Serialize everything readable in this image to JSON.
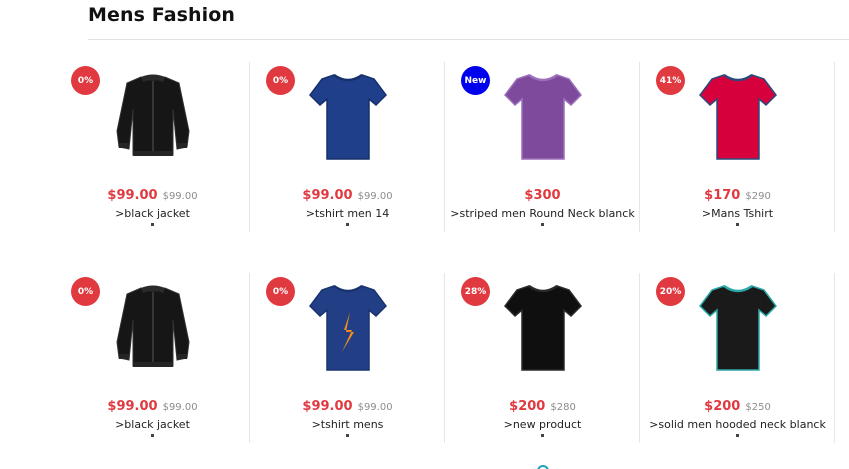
{
  "section": {
    "title": "Mens Fashion"
  },
  "colors": {
    "accent": "#e0393f",
    "badge_sale": "#e0393f",
    "badge_new": "#0000ee"
  },
  "products": [
    {
      "badge": "0%",
      "badge_type": "sale",
      "price": "$99.00",
      "old_price": "$99.00",
      "name": ">black jacket",
      "image": "black-jacket"
    },
    {
      "badge": "0%",
      "badge_type": "sale",
      "price": "$99.00",
      "old_price": "$99.00",
      "name": ">tshirt men 14",
      "image": "navy-tshirt"
    },
    {
      "badge": "New",
      "badge_type": "new",
      "price": "$300",
      "old_price": "",
      "name": ">striped men Round Neck blanck",
      "image": "purple-tshirt"
    },
    {
      "badge": "41%",
      "badge_type": "sale",
      "price": "$170",
      "old_price": "$290",
      "name": ">Mans Tshirt",
      "image": "red-tshirt"
    },
    {
      "badge": "0%",
      "badge_type": "sale",
      "price": "$99.00",
      "old_price": "$99.00",
      "name": ">black jacket",
      "image": "black-jacket"
    },
    {
      "badge": "0%",
      "badge_type": "sale",
      "price": "$99.00",
      "old_price": "$99.00",
      "name": ">tshirt mens",
      "image": "navy-logo-tshirt"
    },
    {
      "badge": "28%",
      "badge_type": "sale",
      "price": "$200",
      "old_price": "$280",
      "name": ">new product",
      "image": "black-tshirt"
    },
    {
      "badge": "20%",
      "badge_type": "sale",
      "price": "$200",
      "old_price": "$250",
      "name": ">solid men hooded neck blanck",
      "image": "black-teal-tshirt"
    }
  ]
}
